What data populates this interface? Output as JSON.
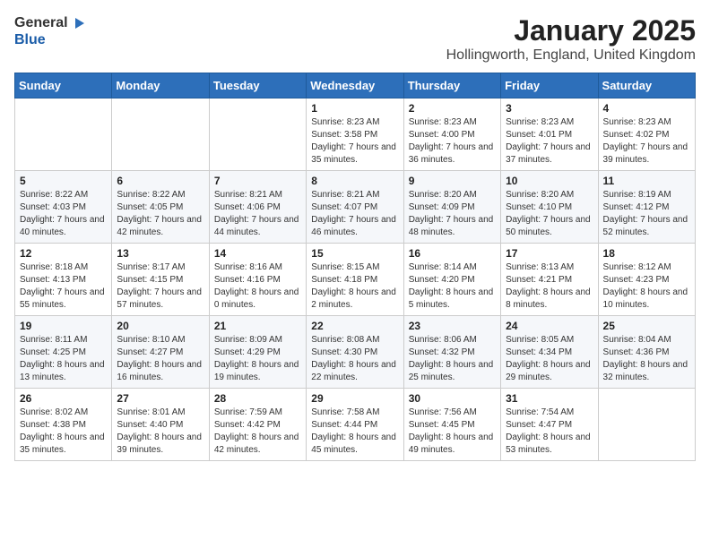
{
  "header": {
    "logo_general": "General",
    "logo_blue": "Blue",
    "title": "January 2025",
    "subtitle": "Hollingworth, England, United Kingdom"
  },
  "weekdays": [
    "Sunday",
    "Monday",
    "Tuesday",
    "Wednesday",
    "Thursday",
    "Friday",
    "Saturday"
  ],
  "weeks": [
    [
      {
        "day": "",
        "info": ""
      },
      {
        "day": "",
        "info": ""
      },
      {
        "day": "",
        "info": ""
      },
      {
        "day": "1",
        "info": "Sunrise: 8:23 AM\nSunset: 3:58 PM\nDaylight: 7 hours and 35 minutes."
      },
      {
        "day": "2",
        "info": "Sunrise: 8:23 AM\nSunset: 4:00 PM\nDaylight: 7 hours and 36 minutes."
      },
      {
        "day": "3",
        "info": "Sunrise: 8:23 AM\nSunset: 4:01 PM\nDaylight: 7 hours and 37 minutes."
      },
      {
        "day": "4",
        "info": "Sunrise: 8:23 AM\nSunset: 4:02 PM\nDaylight: 7 hours and 39 minutes."
      }
    ],
    [
      {
        "day": "5",
        "info": "Sunrise: 8:22 AM\nSunset: 4:03 PM\nDaylight: 7 hours and 40 minutes."
      },
      {
        "day": "6",
        "info": "Sunrise: 8:22 AM\nSunset: 4:05 PM\nDaylight: 7 hours and 42 minutes."
      },
      {
        "day": "7",
        "info": "Sunrise: 8:21 AM\nSunset: 4:06 PM\nDaylight: 7 hours and 44 minutes."
      },
      {
        "day": "8",
        "info": "Sunrise: 8:21 AM\nSunset: 4:07 PM\nDaylight: 7 hours and 46 minutes."
      },
      {
        "day": "9",
        "info": "Sunrise: 8:20 AM\nSunset: 4:09 PM\nDaylight: 7 hours and 48 minutes."
      },
      {
        "day": "10",
        "info": "Sunrise: 8:20 AM\nSunset: 4:10 PM\nDaylight: 7 hours and 50 minutes."
      },
      {
        "day": "11",
        "info": "Sunrise: 8:19 AM\nSunset: 4:12 PM\nDaylight: 7 hours and 52 minutes."
      }
    ],
    [
      {
        "day": "12",
        "info": "Sunrise: 8:18 AM\nSunset: 4:13 PM\nDaylight: 7 hours and 55 minutes."
      },
      {
        "day": "13",
        "info": "Sunrise: 8:17 AM\nSunset: 4:15 PM\nDaylight: 7 hours and 57 minutes."
      },
      {
        "day": "14",
        "info": "Sunrise: 8:16 AM\nSunset: 4:16 PM\nDaylight: 8 hours and 0 minutes."
      },
      {
        "day": "15",
        "info": "Sunrise: 8:15 AM\nSunset: 4:18 PM\nDaylight: 8 hours and 2 minutes."
      },
      {
        "day": "16",
        "info": "Sunrise: 8:14 AM\nSunset: 4:20 PM\nDaylight: 8 hours and 5 minutes."
      },
      {
        "day": "17",
        "info": "Sunrise: 8:13 AM\nSunset: 4:21 PM\nDaylight: 8 hours and 8 minutes."
      },
      {
        "day": "18",
        "info": "Sunrise: 8:12 AM\nSunset: 4:23 PM\nDaylight: 8 hours and 10 minutes."
      }
    ],
    [
      {
        "day": "19",
        "info": "Sunrise: 8:11 AM\nSunset: 4:25 PM\nDaylight: 8 hours and 13 minutes."
      },
      {
        "day": "20",
        "info": "Sunrise: 8:10 AM\nSunset: 4:27 PM\nDaylight: 8 hours and 16 minutes."
      },
      {
        "day": "21",
        "info": "Sunrise: 8:09 AM\nSunset: 4:29 PM\nDaylight: 8 hours and 19 minutes."
      },
      {
        "day": "22",
        "info": "Sunrise: 8:08 AM\nSunset: 4:30 PM\nDaylight: 8 hours and 22 minutes."
      },
      {
        "day": "23",
        "info": "Sunrise: 8:06 AM\nSunset: 4:32 PM\nDaylight: 8 hours and 25 minutes."
      },
      {
        "day": "24",
        "info": "Sunrise: 8:05 AM\nSunset: 4:34 PM\nDaylight: 8 hours and 29 minutes."
      },
      {
        "day": "25",
        "info": "Sunrise: 8:04 AM\nSunset: 4:36 PM\nDaylight: 8 hours and 32 minutes."
      }
    ],
    [
      {
        "day": "26",
        "info": "Sunrise: 8:02 AM\nSunset: 4:38 PM\nDaylight: 8 hours and 35 minutes."
      },
      {
        "day": "27",
        "info": "Sunrise: 8:01 AM\nSunset: 4:40 PM\nDaylight: 8 hours and 39 minutes."
      },
      {
        "day": "28",
        "info": "Sunrise: 7:59 AM\nSunset: 4:42 PM\nDaylight: 8 hours and 42 minutes."
      },
      {
        "day": "29",
        "info": "Sunrise: 7:58 AM\nSunset: 4:44 PM\nDaylight: 8 hours and 45 minutes."
      },
      {
        "day": "30",
        "info": "Sunrise: 7:56 AM\nSunset: 4:45 PM\nDaylight: 8 hours and 49 minutes."
      },
      {
        "day": "31",
        "info": "Sunrise: 7:54 AM\nSunset: 4:47 PM\nDaylight: 8 hours and 53 minutes."
      },
      {
        "day": "",
        "info": ""
      }
    ]
  ]
}
